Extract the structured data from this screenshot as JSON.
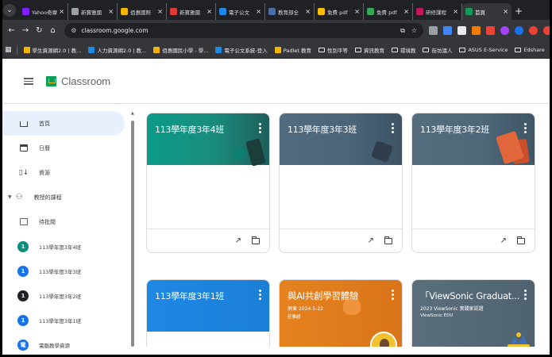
{
  "browser": {
    "tabs": [
      {
        "title": "Yahoo奇摩",
        "color": "#7e1fff"
      },
      {
        "title": "新寶雅國",
        "color": "#9aa0a6"
      },
      {
        "title": "佰惠國照",
        "color": "#f4b400"
      },
      {
        "title": "新寶雅國",
        "color": "#e53935"
      },
      {
        "title": "電子公文",
        "color": "#1e88e5"
      },
      {
        "title": "教育部全",
        "color": "#4a6fa5"
      },
      {
        "title": "免費 pdf",
        "color": "#fbbc05"
      },
      {
        "title": "免費 pdf",
        "color": "#34a853"
      },
      {
        "title": "研修課程",
        "color": "#c2185b"
      },
      {
        "title": "首頁",
        "color": "#0f9d58"
      }
    ],
    "active_tab_index": 9,
    "url": "classroom.google.com",
    "bookmarks": [
      {
        "label": "學生資源網2.0 | 教...",
        "color": "#f4b400"
      },
      {
        "label": "人力資源網2.0 | 教...",
        "color": "#1e88e5"
      },
      {
        "label": "佰惠國民小學 - 學...",
        "color": "#f4b400"
      },
      {
        "label": "電子公文系統-登入",
        "color": "#1e88e5"
      },
      {
        "label": "Padlet 教育",
        "color": "#f4b400"
      },
      {
        "label": "性別平等",
        "folder": true
      },
      {
        "label": "資訊教育",
        "folder": true
      },
      {
        "label": "環境教",
        "folder": true
      },
      {
        "label": "街坊議人",
        "folder": true
      },
      {
        "label": "ASUS E-Service",
        "folder": true
      },
      {
        "label": "Edshare",
        "folder": true
      }
    ]
  },
  "header": {
    "app_name": "Classroom"
  },
  "sidebar": {
    "items": [
      {
        "label": "首頁"
      },
      {
        "label": "日曆"
      },
      {
        "label": "資源"
      }
    ],
    "section_label": "教授的課程",
    "todo_label": "待批閱",
    "courses": [
      {
        "label": "113學年度3年4班",
        "avatar": "1",
        "color": "#0b8f7c"
      },
      {
        "label": "113學年度3年3班",
        "avatar": "1",
        "color": "#1a73e8"
      },
      {
        "label": "113學年度3年2班",
        "avatar": "1",
        "color": "#202124"
      },
      {
        "label": "113學年度3年1班",
        "avatar": "1",
        "color": "#1a73e8"
      },
      {
        "label": "電腦教學資源",
        "avatar": "電",
        "color": "#1a73e8"
      }
    ]
  },
  "cards": [
    {
      "title": "113學年度3年4班"
    },
    {
      "title": "113學年度3年3班"
    },
    {
      "title": "113學年度3年2班"
    },
    {
      "title": "113學年度3年1班"
    },
    {
      "title": "與AI共創學習體驗",
      "line1": "屏東 2024-5-22",
      "line2": "莊雅超"
    },
    {
      "title": "「ViewSonic Graduat...",
      "line1": "2023 ViewSonic 實踐家認證",
      "line2": "ViewSonic EDU"
    }
  ]
}
